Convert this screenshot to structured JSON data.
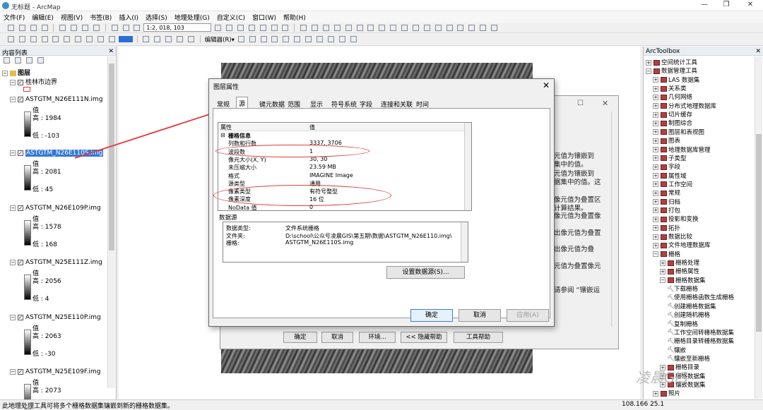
{
  "window": {
    "title": "无标题 - ArcMap"
  },
  "menu": [
    "文件(F)",
    "编辑(E)",
    "视图(V)",
    "书签(B)",
    "插入(I)",
    "选择(S)",
    "地理处理(G)",
    "自定义(C)",
    "窗口(W)",
    "帮助(H)"
  ],
  "toolbar": {
    "scale": "1:2, 018, 103",
    "editor_label": "编辑器(R)▾"
  },
  "toc": {
    "header": "内容列表",
    "root": "图层",
    "layers": [
      {
        "name": "桂林市边界"
      },
      {
        "name": "ASTGTM_N26E111N.img",
        "value_label": "值",
        "high": "高 : 1984",
        "low": "低 : -103"
      },
      {
        "name": "ASTGTM_N26E110S.img",
        "value_label": "值",
        "high": "高 : 2081",
        "low": "低 : 45"
      },
      {
        "name": "ASTGTM_N26E109P.img",
        "value_label": "值",
        "high": "高 : 1578",
        "low": "低 : 168"
      },
      {
        "name": "ASTGTM_N25E111Z.img",
        "value_label": "值",
        "high": "高 : 2056",
        "low": "低 : 4"
      },
      {
        "name": "ASTGTM_N25E110P.img",
        "value_label": "值",
        "high": "高 : 2063",
        "low": "低 : -30"
      },
      {
        "name": "ASTGTM_N25E109F.img",
        "value_label": "值",
        "high": "高 : 2073"
      }
    ]
  },
  "toolbox": {
    "header": "ArcToolbox",
    "items": [
      {
        "label": "空间统计工具",
        "type": "box",
        "indent": 0,
        "exp": "+"
      },
      {
        "label": "数据管理工具",
        "type": "box",
        "indent": 0,
        "exp": "−"
      },
      {
        "label": "LAS 数据集",
        "type": "box",
        "indent": 1,
        "exp": "+"
      },
      {
        "label": "关系类",
        "type": "box",
        "indent": 1,
        "exp": "+"
      },
      {
        "label": "几何网络",
        "type": "box",
        "indent": 1,
        "exp": "+"
      },
      {
        "label": "分布式地理数据库",
        "type": "box",
        "indent": 1,
        "exp": "+"
      },
      {
        "label": "切片缓存",
        "type": "box",
        "indent": 1,
        "exp": "+"
      },
      {
        "label": "制图综合",
        "type": "box",
        "indent": 1,
        "exp": "+"
      },
      {
        "label": "图层和表视图",
        "type": "box",
        "indent": 1,
        "exp": "+"
      },
      {
        "label": "图表",
        "type": "box",
        "indent": 1,
        "exp": "+"
      },
      {
        "label": "地理数据库管理",
        "type": "box",
        "indent": 1,
        "exp": "+"
      },
      {
        "label": "子类型",
        "type": "box",
        "indent": 1,
        "exp": "+"
      },
      {
        "label": "字段",
        "type": "box",
        "indent": 1,
        "exp": "+"
      },
      {
        "label": "属性域",
        "type": "box",
        "indent": 1,
        "exp": "+"
      },
      {
        "label": "工作空间",
        "type": "box",
        "indent": 1,
        "exp": "+"
      },
      {
        "label": "常规",
        "type": "box",
        "indent": 1,
        "exp": "+"
      },
      {
        "label": "归档",
        "type": "box",
        "indent": 1,
        "exp": "+"
      },
      {
        "label": "打包",
        "type": "box",
        "indent": 1,
        "exp": "+"
      },
      {
        "label": "投影和变换",
        "type": "box",
        "indent": 1,
        "exp": "+"
      },
      {
        "label": "拓扑",
        "type": "box",
        "indent": 1,
        "exp": "+"
      },
      {
        "label": "数据比较",
        "type": "box",
        "indent": 1,
        "exp": "+"
      },
      {
        "label": "文件地理数据库",
        "type": "box",
        "indent": 1,
        "exp": "+"
      },
      {
        "label": "栅格",
        "type": "box",
        "indent": 1,
        "exp": "−"
      },
      {
        "label": "栅格处理",
        "type": "box",
        "indent": 2,
        "exp": "+"
      },
      {
        "label": "栅格属性",
        "type": "box",
        "indent": 2,
        "exp": "+"
      },
      {
        "label": "栅格数据集",
        "type": "box",
        "indent": 2,
        "exp": "−"
      },
      {
        "label": "下载栅格",
        "type": "tool",
        "indent": 3
      },
      {
        "label": "使用栅格函数生成栅格",
        "type": "tool",
        "indent": 3
      },
      {
        "label": "创建栅格数据集",
        "type": "tool",
        "indent": 3
      },
      {
        "label": "创建随机栅格",
        "type": "tool",
        "indent": 3
      },
      {
        "label": "复制栅格",
        "type": "tool",
        "indent": 3
      },
      {
        "label": "工作空间转栅格数据集",
        "type": "tool",
        "indent": 3
      },
      {
        "label": "栅格目录转栅格数据集",
        "type": "tool",
        "indent": 3
      },
      {
        "label": "镶嵌",
        "type": "tool",
        "indent": 3
      },
      {
        "label": "镶嵌至新栅格",
        "type": "tool",
        "indent": 3
      },
      {
        "label": "栅格目录",
        "type": "box",
        "indent": 2,
        "exp": "+"
      },
      {
        "label": "栅格数据集",
        "type": "box",
        "indent": 2,
        "exp": "+"
      },
      {
        "label": "镶嵌数据集",
        "type": "box",
        "indent": 2,
        "exp": "+"
      },
      {
        "label": "照片",
        "type": "box",
        "indent": 1,
        "exp": "+"
      }
    ]
  },
  "behind_dialog": {
    "lines": [
      "元值为镶嵌到",
      "集中的值。",
      "元值为镶嵌到",
      "据集中的值。这",
      "像元值为叠置区",
      "计算结果。",
      "像元值为叠置像",
      "出像元值为叠置",
      "出像元值为叠",
      "元值为叠置像元",
      "请参阅 “镶嵌运"
    ],
    "buttons": [
      "确定",
      "取消",
      "环境...",
      "<< 隐藏帮助",
      "工具帮助"
    ]
  },
  "dialog": {
    "title": "图层属性",
    "tabs": [
      "常规",
      "源",
      "键元数据",
      "范围",
      "显示",
      "符号系统",
      "字段",
      "连接和关联",
      "时间"
    ],
    "col_property": "属性",
    "col_value": "值",
    "rows": [
      {
        "k": "栅格信息",
        "v": "",
        "group": true
      },
      {
        "k": "列数和行数",
        "v": "3337, 3706"
      },
      {
        "k": "波段数",
        "v": "1"
      },
      {
        "k": "像元大小(X, Y)",
        "v": "30, 30"
      },
      {
        "k": "未压缩大小",
        "v": "23.59 MB"
      },
      {
        "k": "格式",
        "v": "IMAGINE Image"
      },
      {
        "k": "源类型",
        "v": "通用"
      },
      {
        "k": "像素类型",
        "v": "有符号整型"
      },
      {
        "k": "像素深度",
        "v": "16 位"
      },
      {
        "k": "NoData 值",
        "v": "0"
      }
    ],
    "datasource_label": "数据源",
    "datasource": [
      {
        "k": "数据类型:",
        "v": "文件系统栅格"
      },
      {
        "k": "文件夹:",
        "v": "D:\\school\\公众号凌晨GIS\\第五期\\数据\\ASTGTM_N26E110.img\\"
      },
      {
        "k": "栅格:",
        "v": "ASTGTM_N26E110S.img"
      }
    ],
    "set_source": "设置数据源(S)...",
    "ok": "确定",
    "cancel": "取消",
    "apply": "应用(A)"
  },
  "status": {
    "left": "此地理处理工具可将多个栅格数据集镶嵌到新的栅格数据集。",
    "coords": "108.166  25.1"
  },
  "watermark": "凌晨GIS"
}
